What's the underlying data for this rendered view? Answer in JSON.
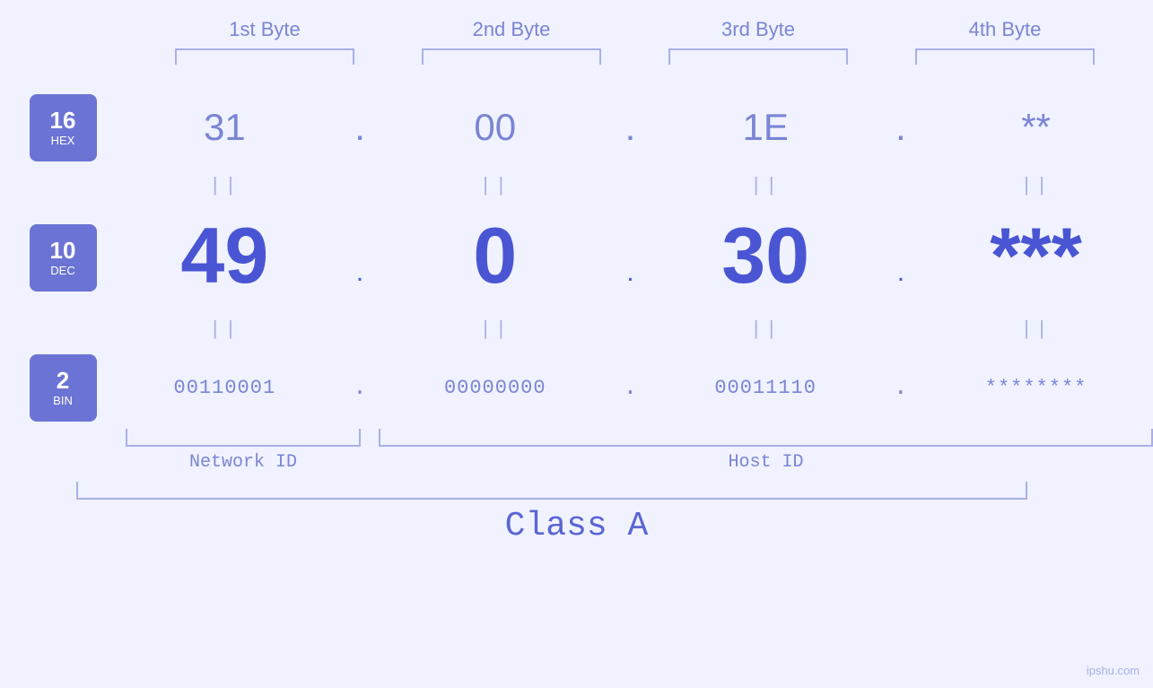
{
  "page": {
    "background": "#f0f2ff",
    "watermark": "ipshu.com"
  },
  "headers": {
    "byte1": "1st Byte",
    "byte2": "2nd Byte",
    "byte3": "3rd Byte",
    "byte4": "4th Byte"
  },
  "badges": {
    "hex": {
      "number": "16",
      "label": "HEX"
    },
    "dec": {
      "number": "10",
      "label": "DEC"
    },
    "bin": {
      "number": "2",
      "label": "BIN"
    }
  },
  "values": {
    "hex": {
      "b1": "31",
      "b2": "00",
      "b3": "1E",
      "b4": "**"
    },
    "dec": {
      "b1": "49",
      "b2": "0",
      "b3": "30",
      "b4": "***"
    },
    "bin": {
      "b1": "00110001",
      "b2": "00000000",
      "b3": "00011110",
      "b4": "********"
    }
  },
  "separators": {
    "parallel": "||",
    "dot_hex": ".",
    "dot_dec": ".",
    "dot_bin": "."
  },
  "labels": {
    "network_id": "Network ID",
    "host_id": "Host ID",
    "class": "Class A"
  },
  "colors": {
    "badge_bg": "#6b74d4",
    "hex_text": "#7a85d4",
    "dec_text": "#4a55d4",
    "bin_text": "#7a85d4",
    "bracket": "#aab0e8",
    "parallel": "#aab0e8",
    "dot_hex": "#7a85d4",
    "dot_dec": "#4a55d4",
    "dot_bin": "#7a85d4",
    "label": "#7a85d4",
    "class": "#5a65d4"
  }
}
